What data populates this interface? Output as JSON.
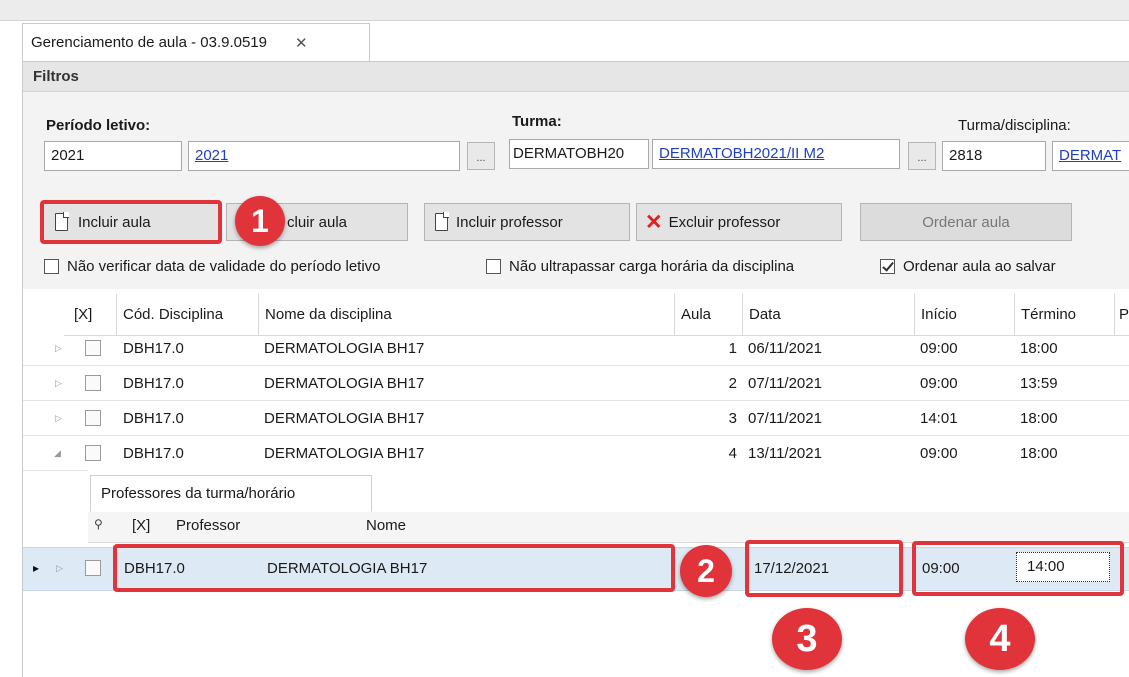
{
  "window": {
    "tab_title": "Gerenciamento de aula - 03.9.0519",
    "close_glyph": "✕"
  },
  "filters": {
    "section_label": "Filtros",
    "periodo": {
      "label": "Período letivo:",
      "code": "2021",
      "link": "2021"
    },
    "turma": {
      "label": "Turma:",
      "code": "DERMATOBH20",
      "link": "DERMATOBH2021/II M2"
    },
    "turma_disciplina": {
      "label": "Turma/disciplina:",
      "code": "2818",
      "link": "DERMAT"
    },
    "ellipsis": "..."
  },
  "toolbar": {
    "incluir_aula": "Incluir aula",
    "excluir_aula_partial": "cluir aula",
    "incluir_professor": "Incluir professor",
    "excluir_professor": "Excluir professor",
    "ordenar_aula": "Ordenar aula"
  },
  "options": {
    "nao_verificar": {
      "label": "Não verificar data de validade do período letivo",
      "checked": false
    },
    "nao_ultrapassar": {
      "label": "Não ultrapassar carga horária da disciplina",
      "checked": false
    },
    "ordenar_ao_salvar": {
      "label": "Ordenar aula ao salvar",
      "checked": true
    }
  },
  "grid": {
    "columns": [
      "[X]",
      "Cód. Disciplina",
      "Nome da disciplina",
      "Aula",
      "Data",
      "Início",
      "Término",
      "P"
    ],
    "rows": [
      {
        "cod": "DBH17.0",
        "nome": "DERMATOLOGIA BH17",
        "aula": "1",
        "data": "06/11/2021",
        "inicio": "09:00",
        "termino": "18:00",
        "expanded": false
      },
      {
        "cod": "DBH17.0",
        "nome": "DERMATOLOGIA BH17",
        "aula": "2",
        "data": "07/11/2021",
        "inicio": "09:00",
        "termino": "13:59",
        "expanded": false
      },
      {
        "cod": "DBH17.0",
        "nome": "DERMATOLOGIA BH17",
        "aula": "3",
        "data": "07/11/2021",
        "inicio": "14:01",
        "termino": "18:00",
        "expanded": false
      },
      {
        "cod": "DBH17.0",
        "nome": "DERMATOLOGIA BH17",
        "aula": "4",
        "data": "13/11/2021",
        "inicio": "09:00",
        "termino": "18:00",
        "expanded": true
      }
    ],
    "detail": {
      "tab_label": "Professores da turma/horário",
      "columns": [
        "[X]",
        "Professor",
        "Nome"
      ],
      "search_glyph": "⚲"
    },
    "selected_row": {
      "cod": "DBH17.0",
      "nome": "DERMATOLOGIA BH17",
      "data": "17/12/2021",
      "inicio": "09:00",
      "termino": "14:00"
    }
  },
  "annotations": {
    "badges": [
      "1",
      "2",
      "3",
      "4"
    ],
    "color": "#e0333a"
  },
  "glyphs": {
    "row_collapsed": "▷",
    "row_expanded": "◢",
    "row_pointer": "▸"
  }
}
